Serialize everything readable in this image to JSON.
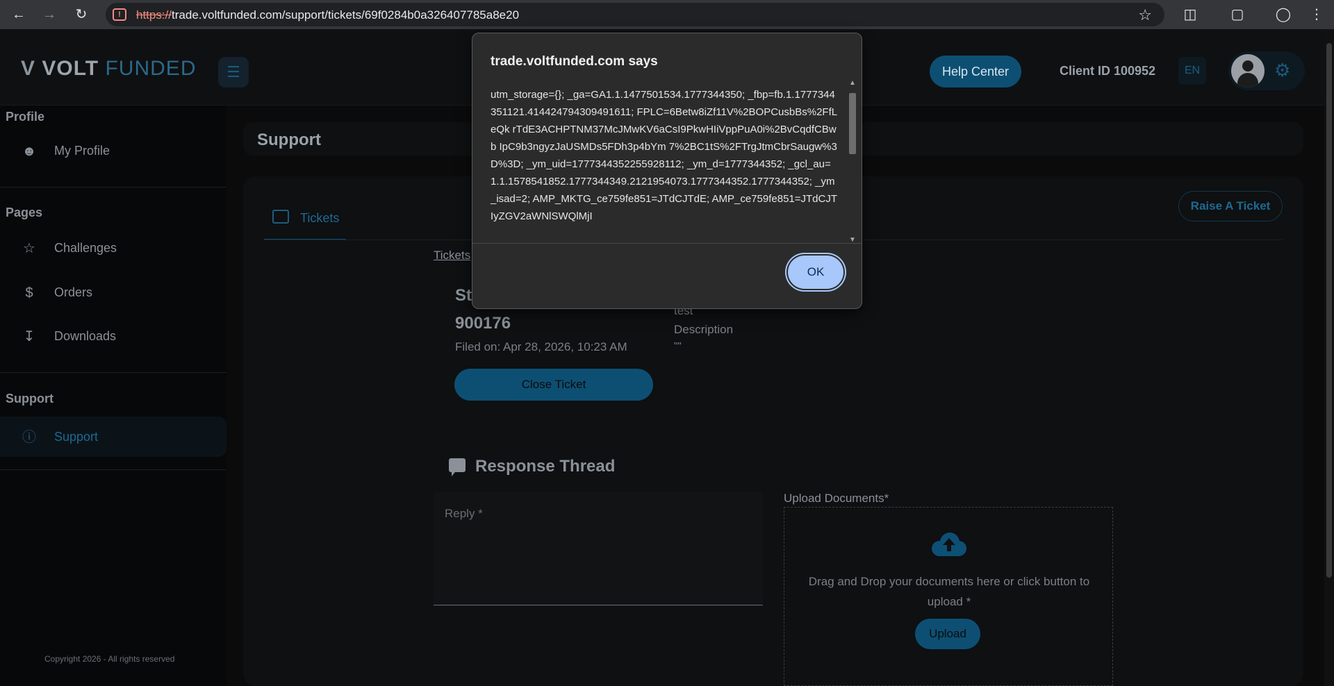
{
  "browser": {
    "url_scheme": "https://",
    "url_rest": "trade.voltfunded.com/support/tickets/69f0284b0a326407785a8e20",
    "back_icon": "back-arrow-icon",
    "forward_icon": "forward-arrow-icon",
    "reload_icon": "reload-icon"
  },
  "header": {
    "logo_v": "V",
    "logo_strong": "VOLT",
    "logo_light": "FUNDED",
    "help_label": "Help Center",
    "client_id": "Client ID 100952",
    "lang": "EN"
  },
  "sidebar": {
    "profile_title": "Profile",
    "my_profile": "My Profile",
    "pages_title": "Pages",
    "challenges": "Challenges",
    "orders": "Orders",
    "downloads": "Downloads",
    "support_title": "Support",
    "support": "Support",
    "copyright": "Copyright 2026 - All rights reserved"
  },
  "main": {
    "page_title": "Support",
    "tab_tickets": "Tickets",
    "raise_ticket": "Raise A Ticket",
    "breadcrumb": "Tickets",
    "status_partial": "St",
    "ticket_id": "900176",
    "filed_on": "Filed on: Apr 28, 2026, 10:23 AM",
    "close_ticket": "Close Ticket",
    "subject": "test",
    "description_label": "Description",
    "description_value": "\"\"",
    "response_thread": "Response Thread",
    "reply_placeholder": "Reply *",
    "upload_label": "Upload Documents*",
    "upload_text": "Drag and Drop your documents here or click button to upload *",
    "upload_button": "Upload"
  },
  "dialog": {
    "title": "trade.voltfunded.com says",
    "message": "utm_storage={}; _ga=GA1.1.1477501534.1777344350; _fbp=fb.1.1777344351121.414424794309491611; FPLC=6Betw8iZf11V%2BOPCusbBs%2FfLeQk rTdE3ACHPTNM37McJMwKV6aCsI9PkwHIiVppPuA0i%2BvCqdfCBwb IpC9b3ngyzJaUSMDs5FDh3p4bYm 7%2BC1tS%2FTrgJtmCbrSaugw%3D%3D; _ym_uid=1777344352255928112; _ym_d=1777344352; _gcl_au=1.1.1578541852.1777344349.2121954073.1777344352.1777344352; _ym_isad=2; AMP_MKTG_ce759fe851=JTdCJTdE; AMP_ce759fe851=JTdCJTIyZGV2aWNlSWQlMjI",
    "ok_label": "OK"
  }
}
